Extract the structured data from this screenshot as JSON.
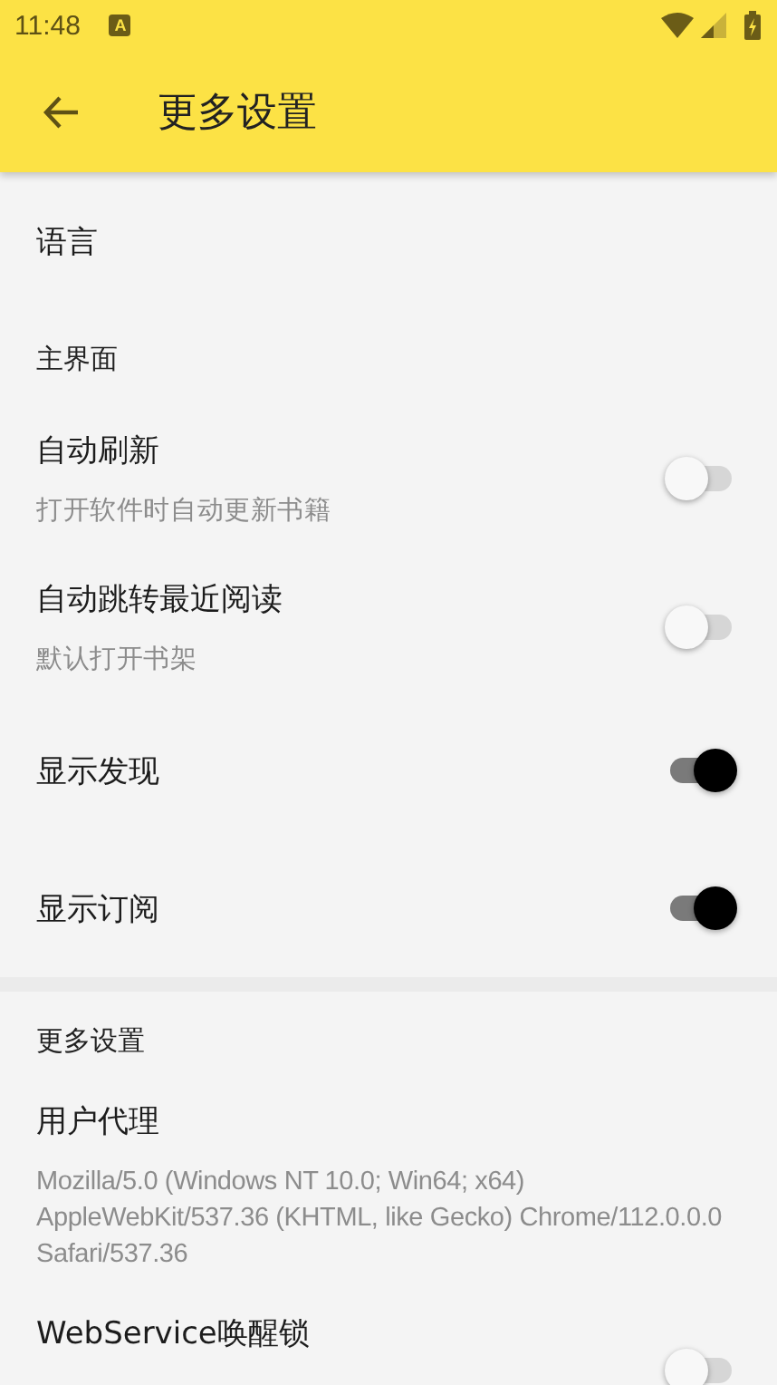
{
  "status_bar": {
    "time": "11:48",
    "notification": "A"
  },
  "app_bar": {
    "title": "更多设置"
  },
  "groups": [
    {
      "items": [
        {
          "kind": "plain",
          "title": "语言"
        },
        {
          "kind": "header",
          "title": "主界面"
        },
        {
          "kind": "switch",
          "title": "自动刷新",
          "summary": "打开软件时自动更新书籍",
          "on": false
        },
        {
          "kind": "switch",
          "title": "自动跳转最近阅读",
          "summary": "默认打开书架",
          "on": false
        },
        {
          "kind": "switch",
          "title": "显示发现",
          "on": true
        },
        {
          "kind": "switch",
          "title": "显示订阅",
          "on": true
        }
      ]
    },
    {
      "items": [
        {
          "kind": "header",
          "title": "更多设置"
        },
        {
          "kind": "plain",
          "title": "用户代理",
          "summary": "Mozilla/5.0 (Windows NT 10.0; Win64; x64) AppleWebKit/537.36 (KHTML, like Gecko) Chrome/112.0.0.0 Safari/537.36"
        },
        {
          "kind": "switch",
          "title": "WebService唤醒锁",
          "on": false
        }
      ]
    }
  ]
}
